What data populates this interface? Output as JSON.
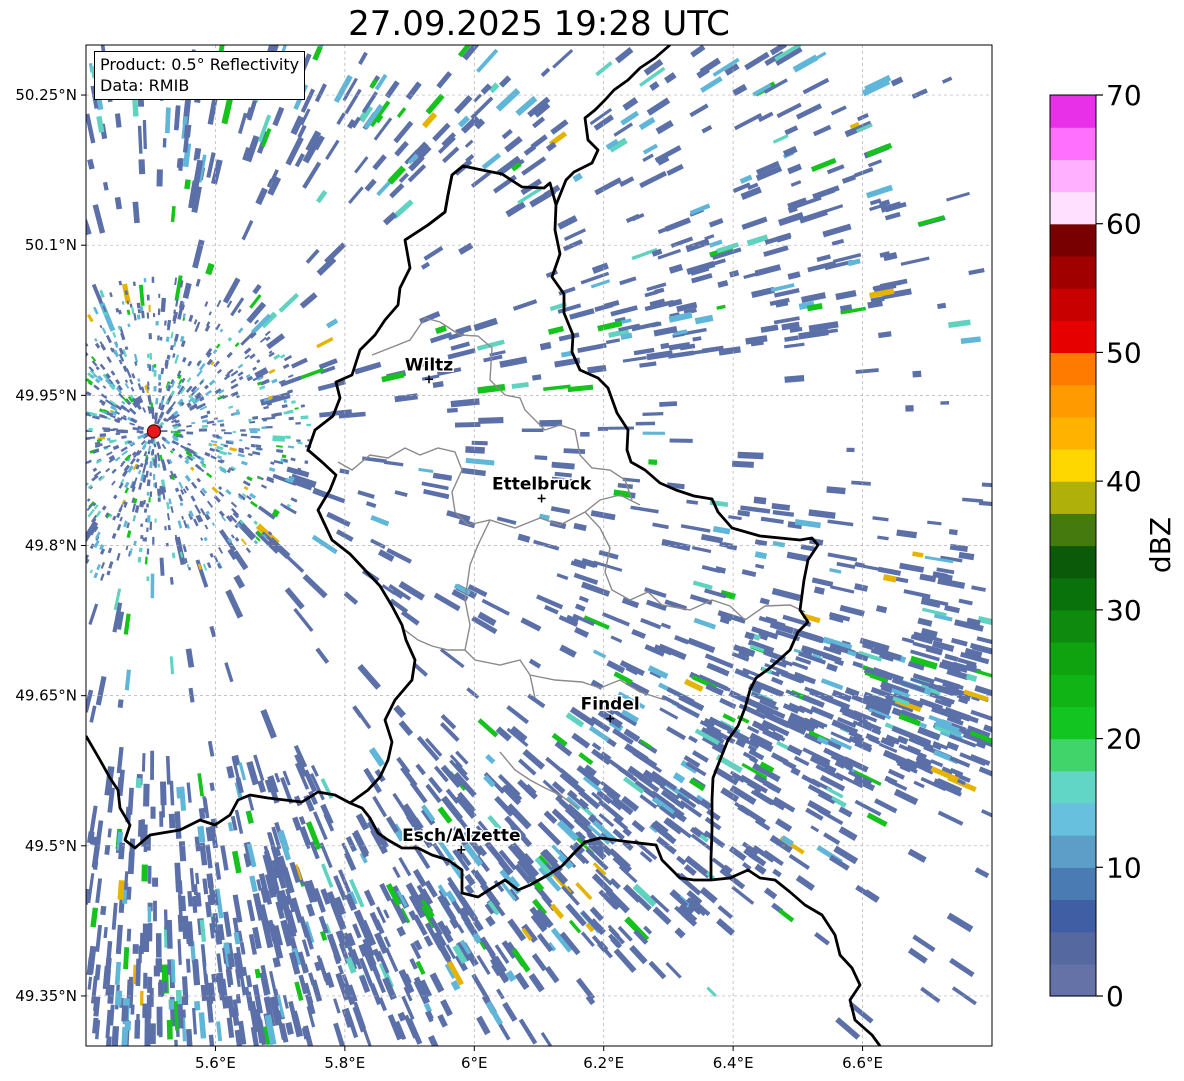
{
  "title": "27.09.2025 19:28 UTC",
  "info": {
    "product": "Product: 0.5° Reflectivity",
    "source": "Data: RMIB"
  },
  "axes": {
    "x_ticks": [
      {
        "value": 5.6,
        "label": "5.6°E"
      },
      {
        "value": 5.8,
        "label": "5.8°E"
      },
      {
        "value": 6.0,
        "label": "6°E"
      },
      {
        "value": 6.2,
        "label": "6.2°E"
      },
      {
        "value": 6.4,
        "label": "6.4°E"
      },
      {
        "value": 6.6,
        "label": "6.6°E"
      }
    ],
    "y_ticks": [
      {
        "value": 50.25,
        "label": "50.25°N"
      },
      {
        "value": 50.1,
        "label": "50.1°N"
      },
      {
        "value": 49.95,
        "label": "49.95°N"
      },
      {
        "value": 49.8,
        "label": "49.8°N"
      },
      {
        "value": 49.65,
        "label": "49.65°N"
      },
      {
        "value": 49.5,
        "label": "49.5°N"
      },
      {
        "value": 49.35,
        "label": "49.35°N"
      }
    ],
    "lon_range": [
      5.4,
      6.8
    ],
    "lat_range": [
      49.3,
      50.3
    ],
    "grid": true
  },
  "radar_site": {
    "lon": 5.505,
    "lat": 49.914
  },
  "cities": [
    {
      "name": "Wiltz",
      "lon": 5.93,
      "lat": 49.966
    },
    {
      "name": "Ettelbruck",
      "lon": 6.104,
      "lat": 49.847
    },
    {
      "name": "Findel",
      "lon": 6.21,
      "lat": 49.627
    },
    {
      "name": "Esch/Alzette",
      "lon": 5.98,
      "lat": 49.496
    }
  ],
  "colorbar": {
    "label": "dBZ",
    "min": 0,
    "max": 70,
    "step": 2.5,
    "tick_values": [
      0,
      10,
      20,
      30,
      40,
      50,
      60,
      70
    ],
    "tick_labels": [
      "0",
      "10",
      "20",
      "30",
      "40",
      "50",
      "60",
      "70"
    ],
    "colors": [
      "#6472a8",
      "#5568a0",
      "#405ea3",
      "#4a7cb3",
      "#5c9ec8",
      "#67c0de",
      "#61d5c6",
      "#40d46b",
      "#12c520",
      "#10b414",
      "#0fa40f",
      "#0e8a0e",
      "#0a720a",
      "#0a5a0a",
      "#457a0f",
      "#b0b00a",
      "#ffd700",
      "#ffb300",
      "#ff9a00",
      "#ff7b00",
      "#e60000",
      "#c80000",
      "#a00000",
      "#780000",
      "#ffe0ff",
      "#ffb0ff",
      "#ff70ff",
      "#e830e8"
    ]
  },
  "echo_palette": {
    "base": "#5b6fa8",
    "light": "#60b6d8",
    "cyan": "#5fd2c0",
    "green": "#16c21c",
    "yellow": "#e5b400"
  }
}
